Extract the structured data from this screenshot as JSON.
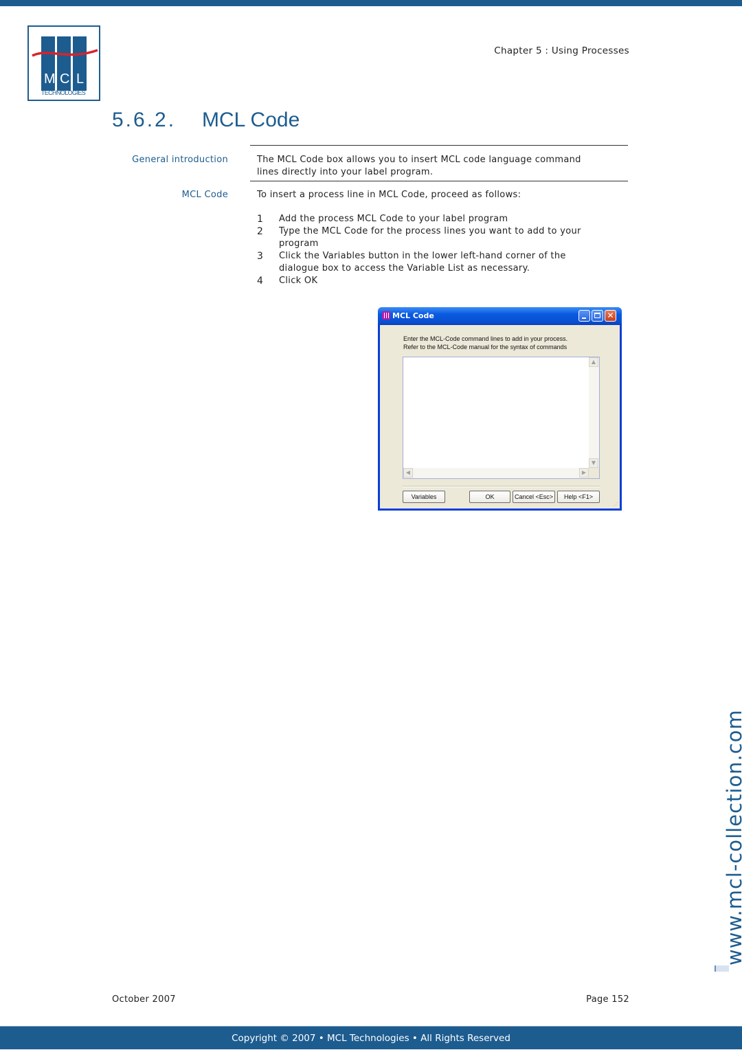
{
  "header": {
    "logo": {
      "letters": [
        "M",
        "C",
        "L"
      ],
      "subtitle": "TECHNOLOGIES",
      "brand_color": "#1d5c8f",
      "wave_color": "#d8232a"
    },
    "chapter": "Chapter 5 : Using Processes"
  },
  "section": {
    "number": "5.6.2.",
    "title": "MCL Code"
  },
  "blocks": [
    {
      "label": "General introduction",
      "text_lines": [
        "The MCL Code box allows you to insert MCL code language command",
        "lines directly into your label program."
      ]
    },
    {
      "label": "MCL Code",
      "text": "To insert a process line in MCL Code, proceed as follows:"
    }
  ],
  "steps": [
    {
      "n": "1",
      "lines": [
        "Add the process MCL Code to your label program"
      ]
    },
    {
      "n": "2",
      "lines": [
        "Type the MCL Code for the process lines you want to add to your",
        "program"
      ]
    },
    {
      "n": "3",
      "lines": [
        "Click the Variables button in the lower left-hand corner of the",
        "dialogue box to access the Variable List as necessary."
      ]
    },
    {
      "n": "4",
      "lines": [
        "Click OK"
      ]
    }
  ],
  "dialog": {
    "title": "MCL Code",
    "instructions": [
      "Enter the MCL-Code command lines to add in your process.",
      "Refer to the MCL-Code manual for the syntax of commands"
    ],
    "code_value": "",
    "buttons": {
      "variables": "Variables",
      "ok": "OK",
      "cancel": "Cancel <Esc>",
      "help": "Help <F1>"
    },
    "icons": {
      "minimize": "minimize-icon",
      "maximize": "maximize-icon",
      "close": "close-icon"
    }
  },
  "watermark": "www.mcl-collection.com",
  "footer": {
    "date": "October 2007",
    "page": "Page  152",
    "copyright": "Copyright © 2007 • MCL Technologies • All Rights Reserved"
  }
}
